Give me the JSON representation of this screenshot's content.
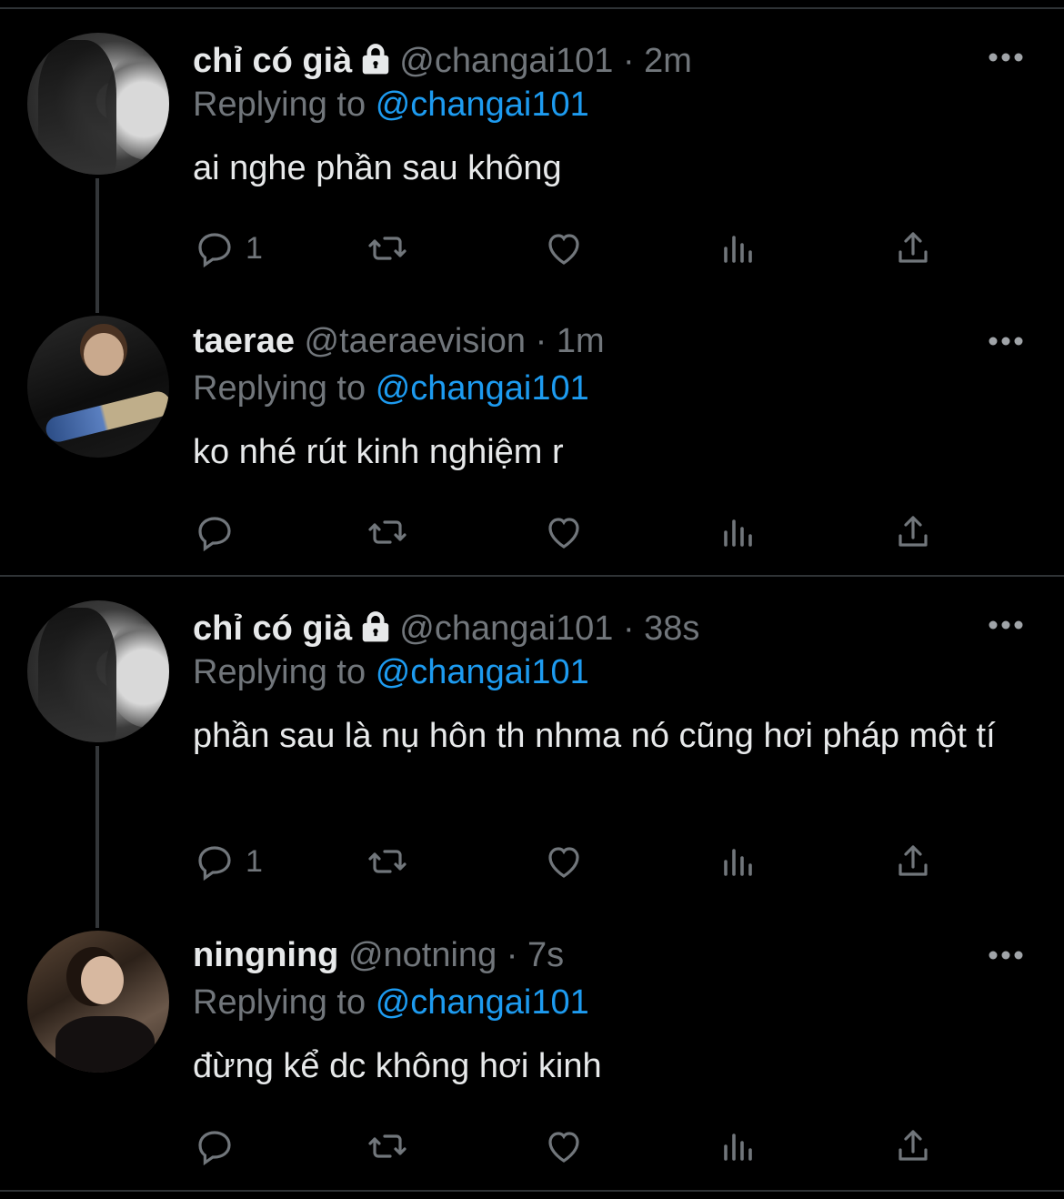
{
  "tweets": [
    {
      "name": "chỉ có già",
      "locked": true,
      "handle": "@changai101",
      "time": "2m",
      "replying_label": "Replying to",
      "replying_handle": "@changai101",
      "text": "ai nghe phần sau không",
      "reply_count": "1"
    },
    {
      "name": "taerae",
      "locked": false,
      "handle": "@taeraevision",
      "time": "1m",
      "replying_label": "Replying to",
      "replying_handle": "@changai101",
      "text": "ko nhé rút kinh nghiệm r",
      "reply_count": ""
    },
    {
      "name": "chỉ có già",
      "locked": true,
      "handle": "@changai101",
      "time": "38s",
      "replying_label": "Replying to",
      "replying_handle": "@changai101",
      "text": "phần sau là nụ hôn th nhma nó cũng hơi pháp một tí",
      "reply_count": "1"
    },
    {
      "name": "ningning",
      "locked": false,
      "handle": "@notning",
      "time": "7s",
      "replying_label": "Replying to",
      "replying_handle": "@changai101",
      "text": "đừng kể dc không hơi kinh",
      "reply_count": ""
    }
  ],
  "separator": "·",
  "icons": [
    "reply-icon",
    "retweet-icon",
    "like-icon",
    "analytics-icon",
    "share-icon",
    "more-icon",
    "lock-icon"
  ],
  "colors": {
    "background": "#000000",
    "text": "#e7e9ea",
    "muted": "#71767b",
    "link": "#1d9bf0",
    "divider": "#2f3336"
  }
}
